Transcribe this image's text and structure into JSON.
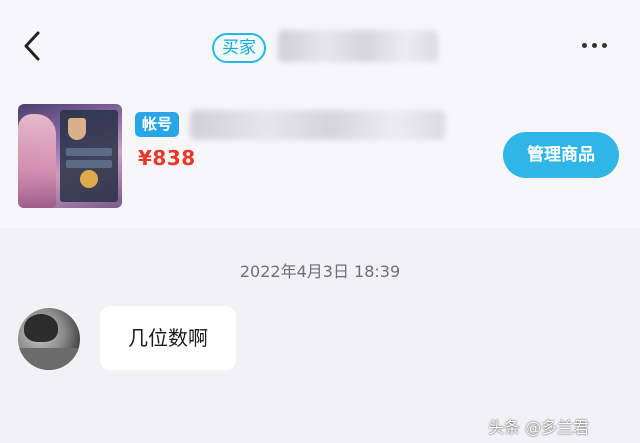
{
  "header": {
    "back_icon": "chevron-left-icon",
    "buyer_badge": "买家",
    "more_icon": "more-horizontal-icon"
  },
  "product": {
    "account_tag": "帐号",
    "price": "¥838",
    "manage_button": "管理商品"
  },
  "chat": {
    "timestamp": "2022年4月3日  18:39",
    "messages": [
      {
        "text": "几位数啊"
      }
    ]
  },
  "watermark": "头条 @多兰君",
  "colors": {
    "accent": "#2fb5e6",
    "price": "#e8372b",
    "background": "#f2f2f5"
  }
}
